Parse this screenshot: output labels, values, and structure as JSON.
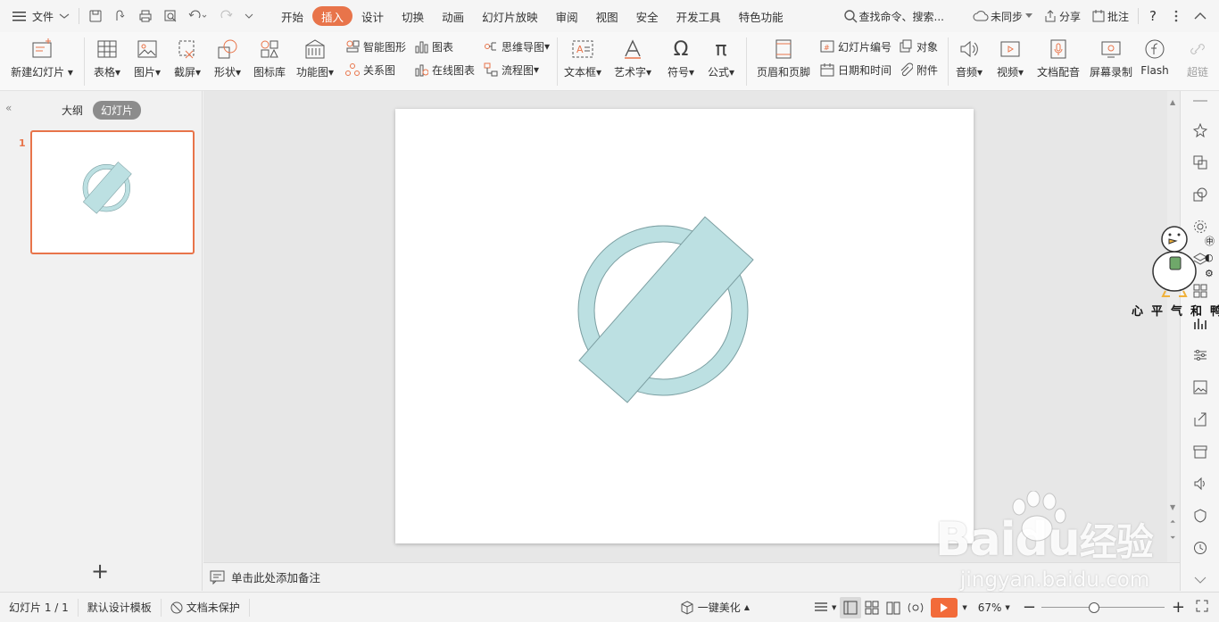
{
  "menu": {
    "file_label": "文件",
    "tabs": [
      "开始",
      "插入",
      "设计",
      "切换",
      "动画",
      "幻灯片放映",
      "审阅",
      "视图",
      "安全",
      "开发工具",
      "特色功能"
    ],
    "active_tab": "插入",
    "search_placeholder": "查找命令、搜索...",
    "sync_label": "未同步",
    "share_label": "分享",
    "comment_label": "批注",
    "help_label": "?"
  },
  "ribbon": {
    "new_slide": "新建幻灯片",
    "table": "表格",
    "picture": "图片",
    "screenshot": "截屏",
    "shape": "形状",
    "icon_lib": "图标库",
    "function_chart": "功能图",
    "smart_art": "智能图形",
    "chart": "图表",
    "relation": "关系图",
    "online_chart": "在线图表",
    "mindmap": "思维导图",
    "flowchart": "流程图",
    "textbox": "文本框",
    "wordart": "艺术字",
    "symbol": "符号",
    "formula": "公式",
    "header_footer": "页眉和页脚",
    "slide_number": "幻灯片编号",
    "object": "对象",
    "datetime": "日期和时间",
    "attachment": "附件",
    "audio": "音频",
    "video": "视频",
    "doc_dub": "文档配音",
    "screen_record": "屏幕录制",
    "flash": "Flash",
    "hyperlink": "超链"
  },
  "left_panel": {
    "outline_tab": "大纲",
    "slides_tab": "幻灯片",
    "slide_index": "1",
    "add_slide": "+"
  },
  "notes": {
    "placeholder": "单击此处添加备注"
  },
  "status": {
    "slide_count": "幻灯片 1 / 1",
    "template": "默认设计模板",
    "protection": "文档未保护",
    "beautify": "一键美化",
    "zoom": "67%",
    "zoom_level": 0.42
  },
  "shape": {
    "fill": "#bce0e2",
    "stroke": "#7d9fa2"
  },
  "watermark": {
    "brand": "Baidu",
    "brand_cn": "经验",
    "url": "jingyan.baidu.com",
    "sticker_text": "心平气和鸭"
  }
}
